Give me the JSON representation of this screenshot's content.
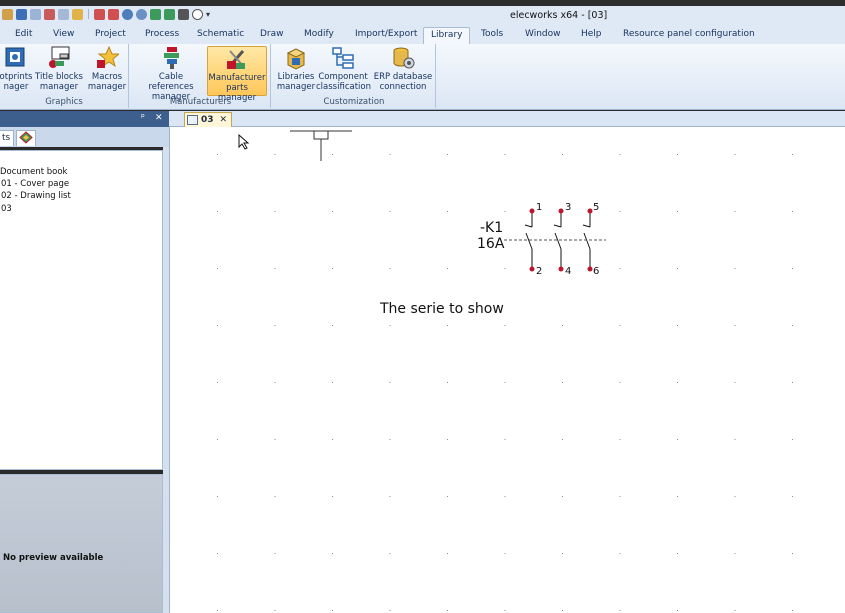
{
  "window": {
    "title": "elecworks x64 - [03]"
  },
  "menu_tabs": [
    "Edit",
    "View",
    "Project",
    "Process",
    "Schematic",
    "Draw",
    "Modify",
    "Import/Export",
    "Library",
    "Tools",
    "Window",
    "Help",
    "Resource panel configuration"
  ],
  "active_tab": "Library",
  "ribbon": {
    "graphics": {
      "label": "Graphics",
      "footprints_1": "otprints",
      "footprints_2": "nager",
      "title_blocks_1": "Title blocks",
      "title_blocks_2": "manager",
      "macros_1": "Macros",
      "macros_2": "manager"
    },
    "manufacturers": {
      "label": "Manufacturers",
      "cable_1": "Cable references",
      "cable_2": "manager",
      "parts_1": "Manufacturer",
      "parts_2": "parts manager"
    },
    "customization": {
      "label": "Customization",
      "libraries_1": "Libraries",
      "libraries_2": "manager",
      "classification_1": "Component",
      "classification_2": "classification",
      "erp_1": "ERP database",
      "erp_2": "connection"
    }
  },
  "left_panel": {
    "pin_glyph": "ᵖ",
    "close_glyph": "✕",
    "tab_label": "ts",
    "tree": [
      "Document book",
      "01 - Cover page",
      "02 - Drawing list",
      "03"
    ],
    "preview_text": "No preview available"
  },
  "document": {
    "tab_label": "03",
    "close_glyph": "✕",
    "component_tag": "-K1",
    "component_rating": "16A",
    "pins_top": [
      "1",
      "3",
      "5"
    ],
    "pins_bottom": [
      "2",
      "4",
      "6"
    ],
    "caption": "The serie to show"
  },
  "colors": {
    "accent": "#3c5f8d",
    "hot": "#ffc75a",
    "wire": "#c0142a"
  }
}
